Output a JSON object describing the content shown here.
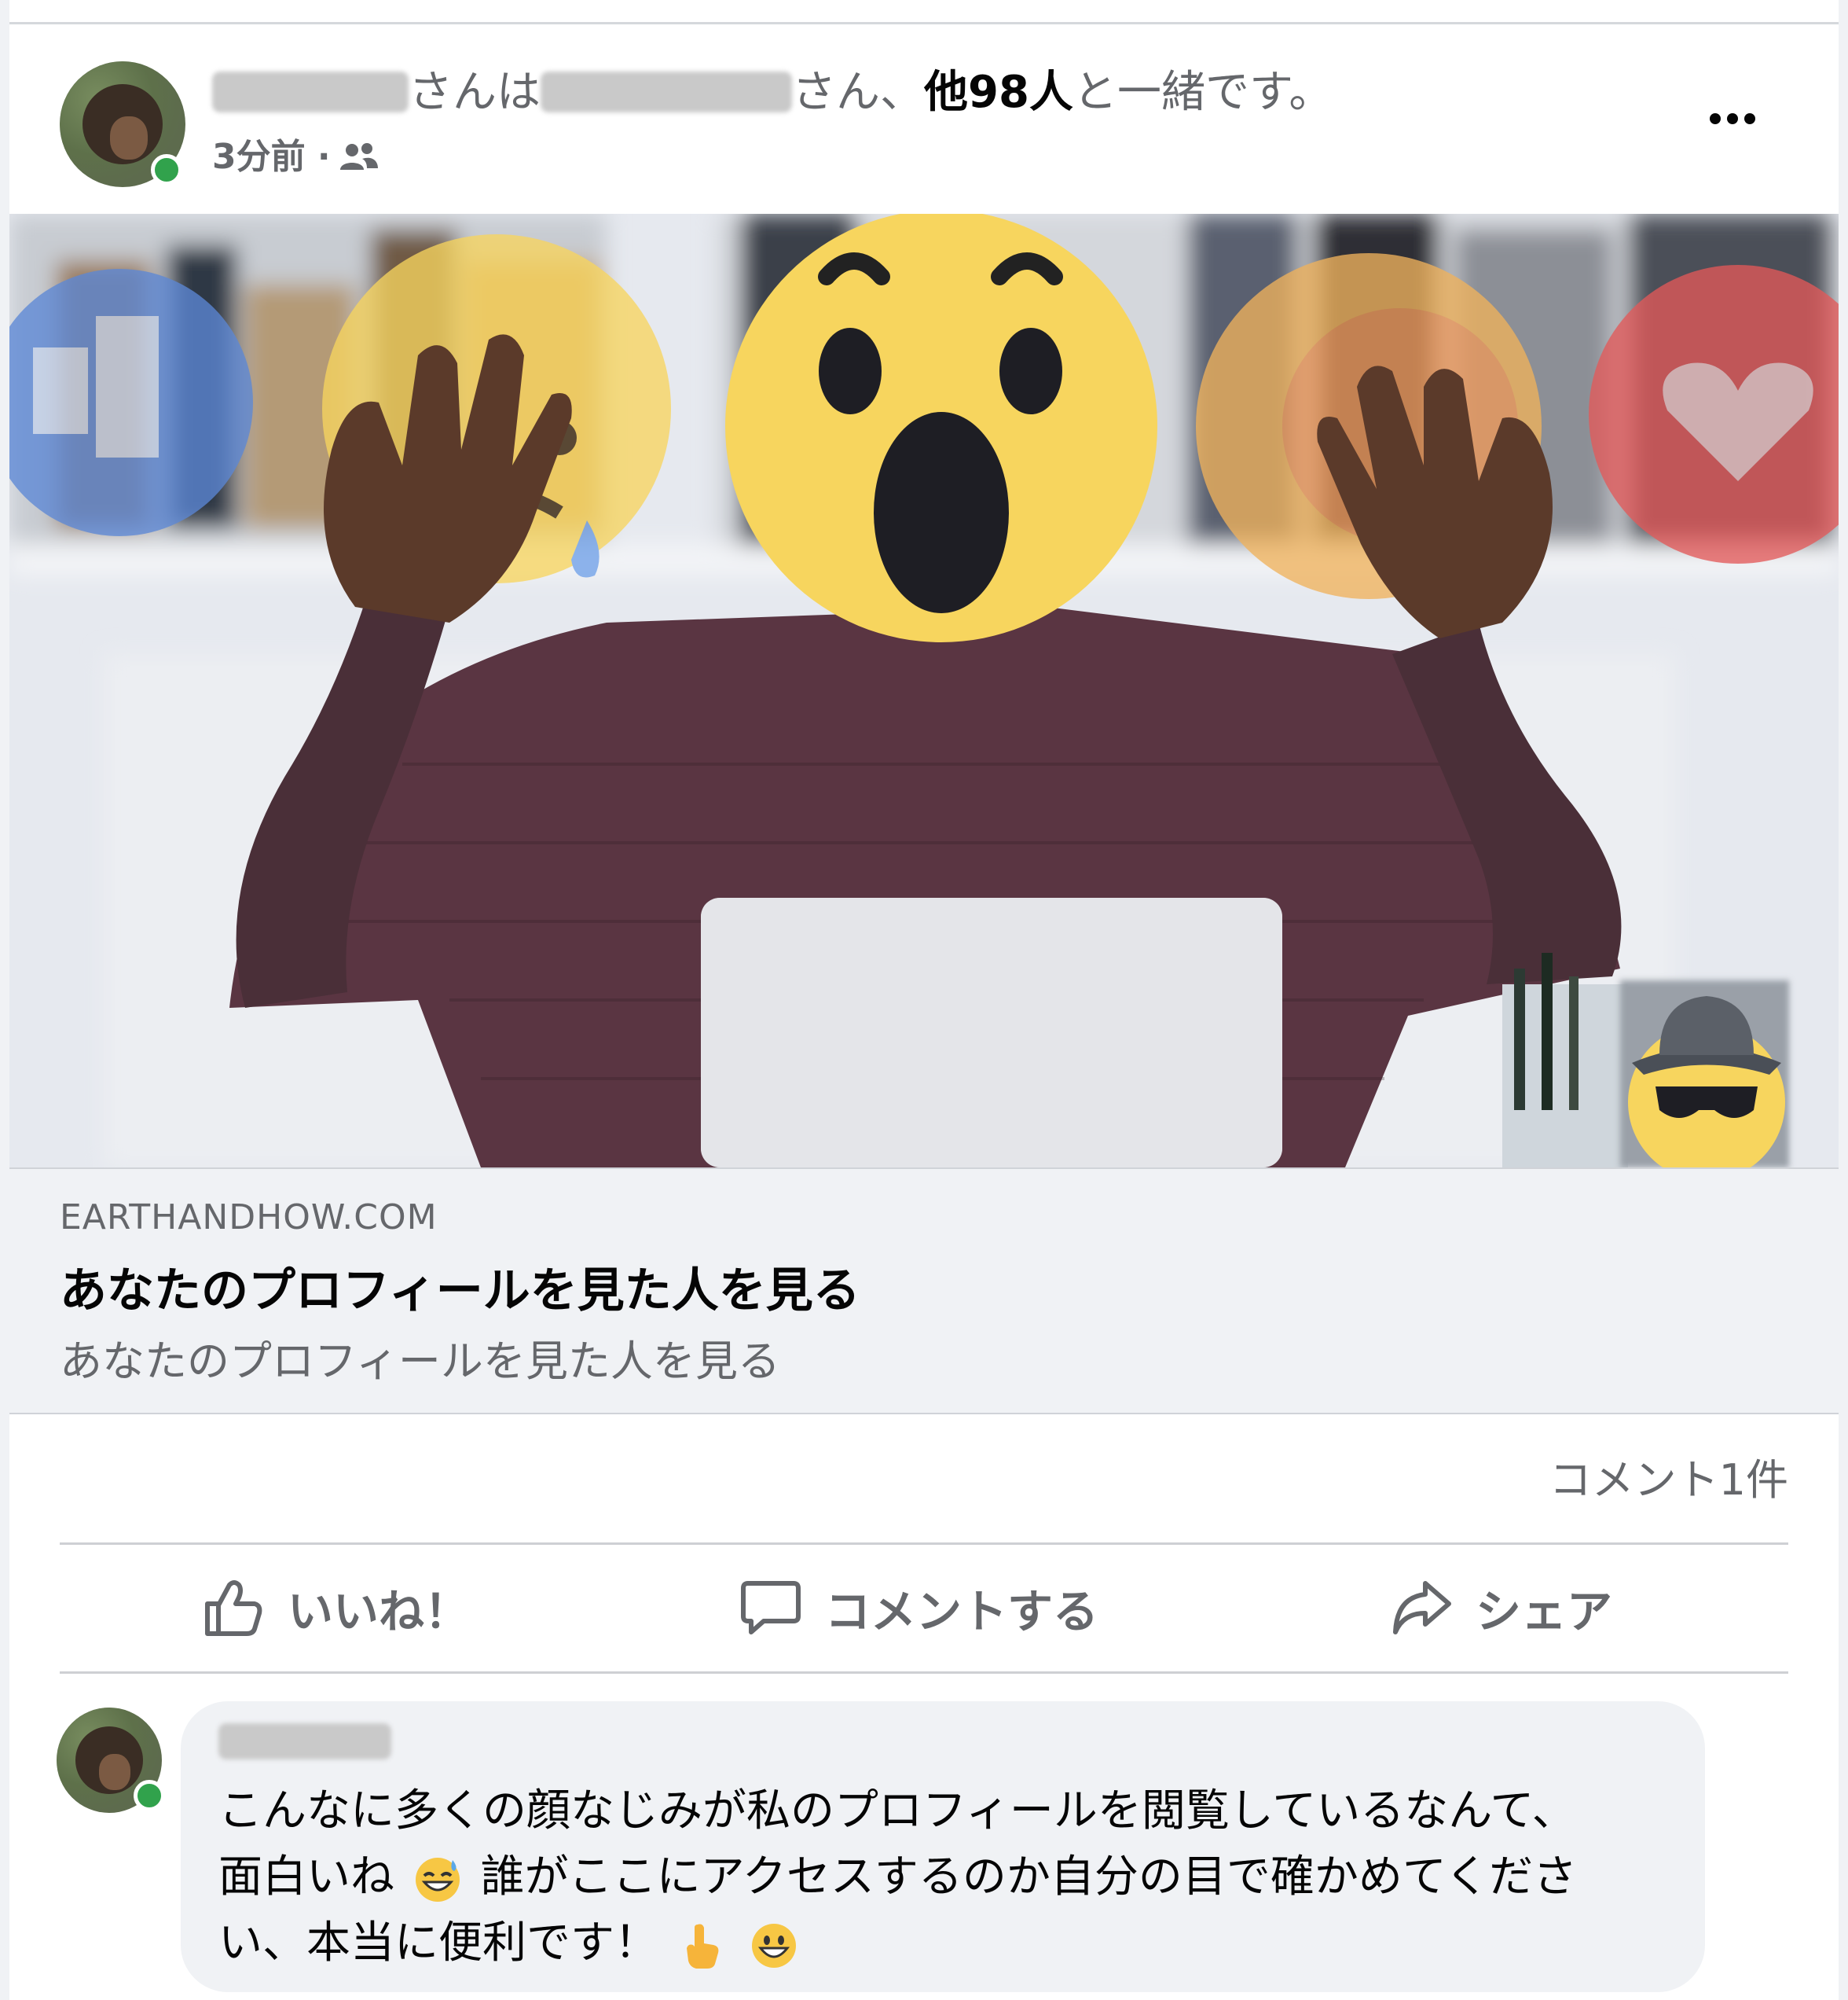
{
  "post": {
    "author_suffix": "さんは",
    "tagged_suffix": "さん、",
    "others_label": "他98人",
    "title_tail": "と一緒です。",
    "time": "3分前 ·",
    "audience_icon": "friends-icon",
    "more_icon": "more-options-icon"
  },
  "link_preview": {
    "domain": "EARTHANDHOW.COM",
    "title": "あなたのプロフィールを見た人を見る",
    "description": "あなたのプロフィールを見た人を見る"
  },
  "stats": {
    "comments": "コメント1件"
  },
  "actions": {
    "like": "いいね！",
    "comment": "コメントする",
    "share": "シェア"
  },
  "comment": {
    "line1": "こんなに多くの顔なじみが私のプロフィールを閲覧しているなんて、",
    "line2a": "面白いね",
    "line2b": "誰がここにアクセスするのか自分の目で確かめてくださ",
    "line3": "い、本当に便利です！",
    "emoji_1": "sweat-smile-emoji",
    "emoji_2": "pointing-up-emoji",
    "emoji_3": "grinning-emoji"
  },
  "colors": {
    "text_secondary": "#65676b",
    "card_bg": "#f0f2f5",
    "reaction_yellow": "#f7d55e",
    "reaction_blue": "#5c88d6",
    "reaction_red": "#e35a5a",
    "online_green": "#31a24c"
  }
}
